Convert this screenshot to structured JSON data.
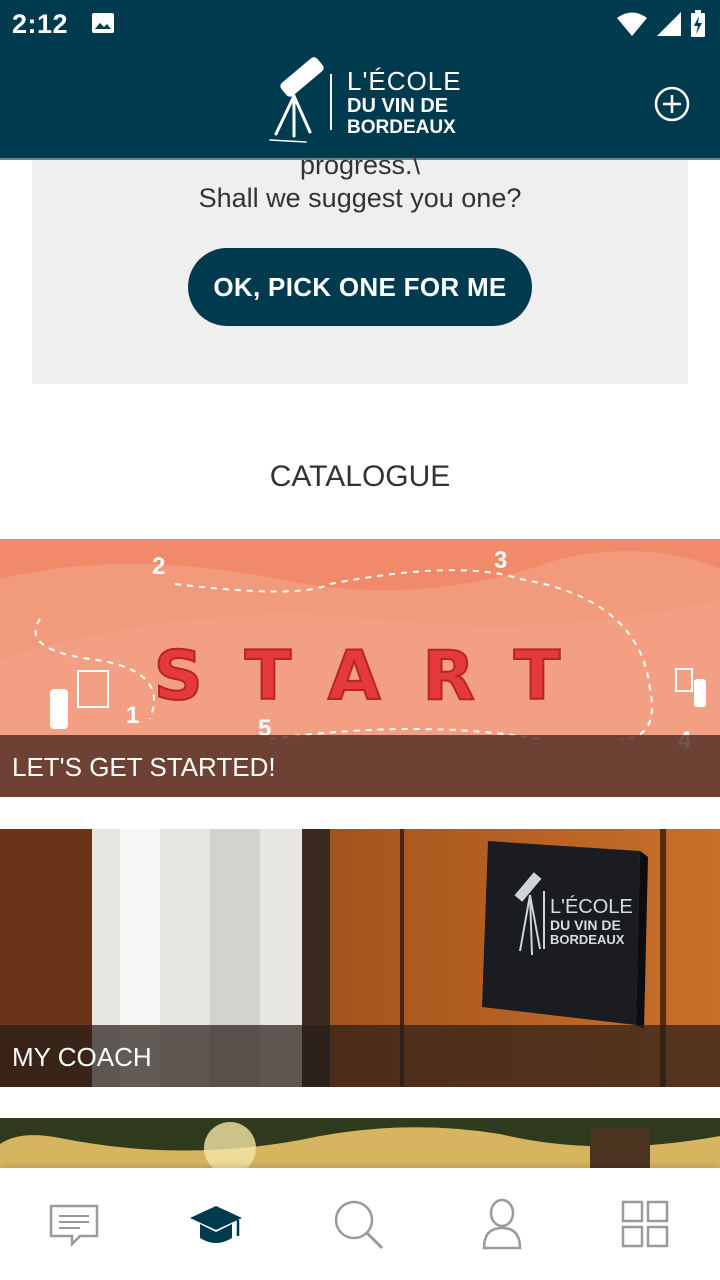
{
  "status_bar": {
    "time": "2:12",
    "icons": [
      "image-icon",
      "wifi-icon",
      "signal-icon",
      "battery-charging-icon"
    ]
  },
  "header": {
    "logo_line1": "L'ÉCOLE",
    "logo_line2": "DU VIN DE",
    "logo_line3": "BORDEAUX",
    "add_icon": "plus-circle-icon"
  },
  "suggestion": {
    "line1": "progress.\\",
    "line2": "Shall we suggest you one?",
    "button_label": "OK, PICK ONE FOR ME"
  },
  "catalogue": {
    "title": "CATALOGUE",
    "items": [
      {
        "caption": "LET'S GET STARTED!",
        "banner_text": "START",
        "steps": [
          "1",
          "2",
          "3",
          "4",
          "5"
        ]
      },
      {
        "caption": "MY COACH",
        "sign_line1": "L'ÉCOLE",
        "sign_line2": "DU VIN DE",
        "sign_line3": "BORDEAUX"
      },
      {
        "caption": ""
      }
    ]
  },
  "bottom_nav": {
    "items": [
      {
        "icon": "messages-icon",
        "active": false
      },
      {
        "icon": "graduation-cap-icon",
        "active": true
      },
      {
        "icon": "search-icon",
        "active": false
      },
      {
        "icon": "user-icon",
        "active": false
      },
      {
        "icon": "grid-icon",
        "active": false
      }
    ]
  },
  "colors": {
    "primary": "#003a4f",
    "card_bg": "#efefef",
    "start_bg": "#f08a6a",
    "start_text": "#e53a3a",
    "nav_inactive": "#9a9a9a"
  }
}
